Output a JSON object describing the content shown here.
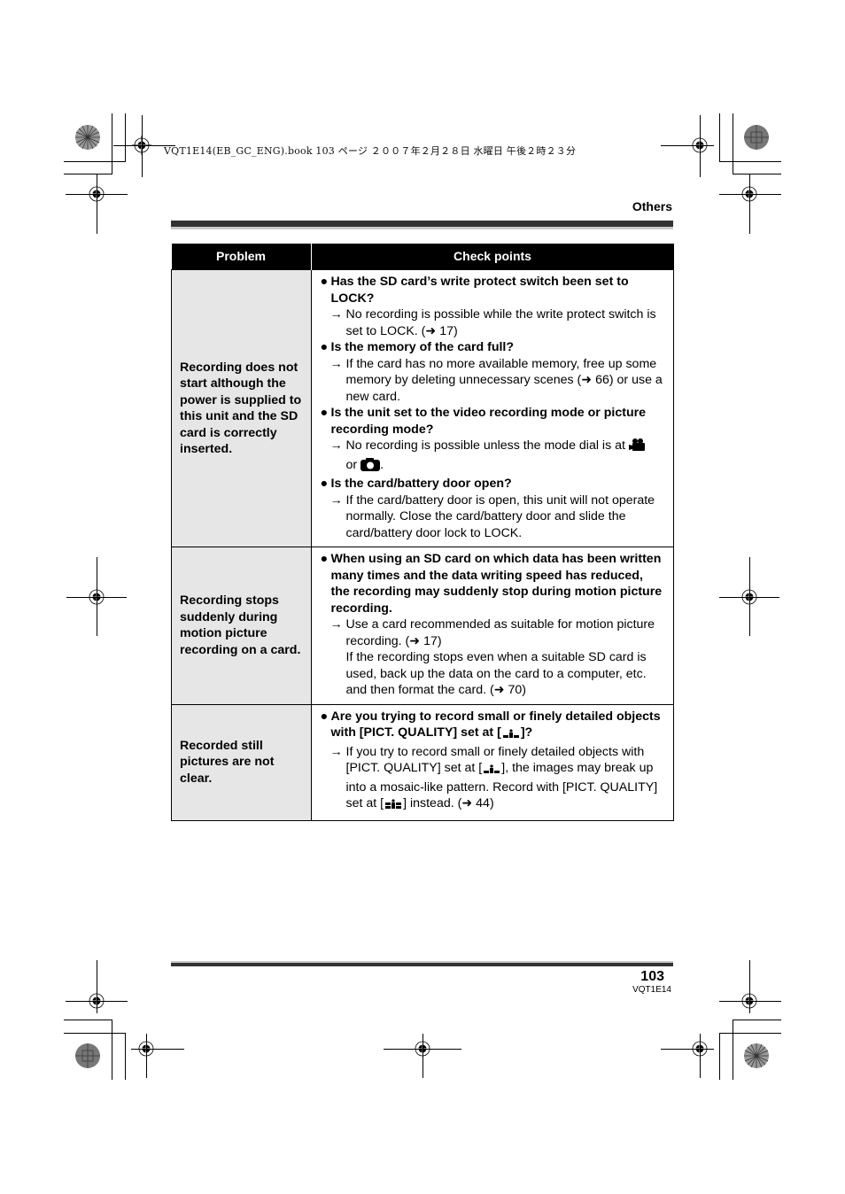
{
  "print_header": "VQT1E14(EB_GC_ENG).book  103 ページ  ２００７年２月２８日  水曜日  午後２時２３分",
  "section_title": "Others",
  "table": {
    "headers": {
      "problem": "Problem",
      "check_points": "Check points"
    },
    "rows": [
      {
        "problem": "Recording does not start although the power is supplied to this unit and the SD card is correctly inserted.",
        "items": [
          {
            "question": "Has the SD card’s write protect switch been set to LOCK?",
            "answer": "No recording is possible while the write protect switch is set to LOCK. (➜ 17)"
          },
          {
            "question": "Is the memory of the card full?",
            "answer": "If the card has no more available memory, free up some memory by deleting unnecessary scenes (➜ 66) or use a new card."
          },
          {
            "question": "Is the unit set to the video recording mode or picture recording mode?",
            "answer_before_icon1": "No recording is possible unless the mode dial is at",
            "icon1": "video-mode-icon",
            "answer_between": "or",
            "icon2": "camera-mode-icon",
            "answer_after": "."
          },
          {
            "question": "Is the card/battery door open?",
            "answer": "If the card/battery door is open, this unit will not operate normally. Close the card/battery door and slide the card/battery door lock to LOCK."
          }
        ]
      },
      {
        "problem": "Recording stops suddenly during motion picture recording on a card.",
        "items": [
          {
            "question": "When using an SD card on which data has been written many times and the data writing speed has reduced, the recording may suddenly stop during motion picture recording.",
            "answer": "Use a card recommended as suitable for motion picture recording. (➜ 17)",
            "answer_extra": "If the recording stops even when a suitable SD card is used, back up the data on the card to a computer, etc. and then format the card. (➜ 70)"
          }
        ]
      },
      {
        "problem": "Recorded still pictures are not clear.",
        "items": [
          {
            "question_before": "Are you trying to record small or finely detailed objects with [PICT. QUALITY] set at [",
            "question_icon": "quality-normal-icon",
            "question_after": "]?",
            "answer_part1": "If you try to record small or finely detailed objects with [PICT. QUALITY] set at [",
            "answer_icon1": "quality-normal-icon",
            "answer_part2": "], the images may break up into a mosaic-like pattern. Record with [PICT. QUALITY] set at [",
            "answer_icon2": "quality-fine-icon",
            "answer_part3": "] instead. (➜ 44)"
          }
        ]
      }
    ]
  },
  "footer": {
    "page_number": "103",
    "model_code": "VQT1E14"
  },
  "glyphs": {
    "bullet": "●",
    "arrow": "→"
  }
}
